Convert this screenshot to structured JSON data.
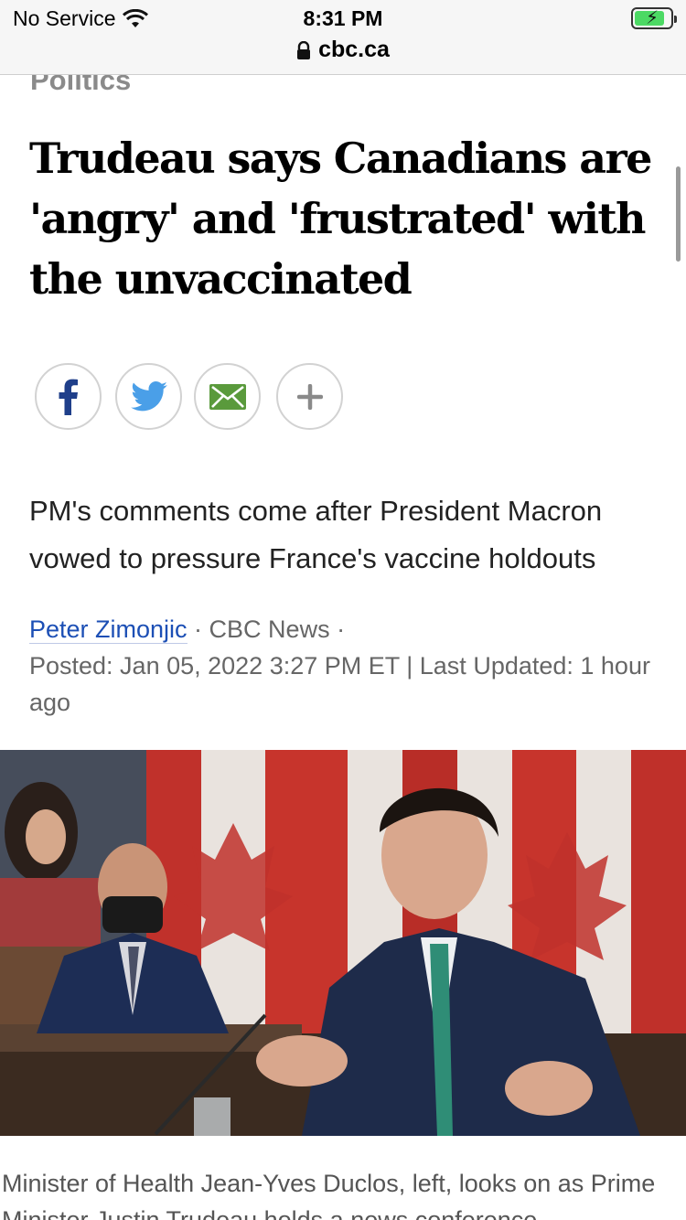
{
  "status_bar": {
    "carrier": "No Service",
    "time": "8:31 PM",
    "url": "cbc.ca",
    "battery_level": 0.85
  },
  "article": {
    "section": "Politics",
    "headline": "Trudeau says Canadians are 'angry' and 'frustrated' with the unvaccinated",
    "share_buttons": [
      "facebook-icon",
      "twitter-icon",
      "email-icon",
      "plus-icon"
    ],
    "deck": "PM's comments come after President Macron vowed to pressure France's vaccine holdouts",
    "byline": {
      "author": "Peter Zimonjic",
      "separator1": " · ",
      "outlet": "CBC News",
      "separator2": " ·",
      "posted": "Posted: Jan 05, 2022 3:27 PM ET | Last Updated: 1 hour ago"
    },
    "caption": "Minister of Health Jean-Yves Duclos, left, looks on as Prime Minister Justin Trudeau holds a news conference"
  },
  "colors": {
    "link": "#1c4fb5",
    "section": "#8a8a8a",
    "email_icon": "#5a9a3c",
    "twitter_icon": "#4a9fe8",
    "facebook_icon": "#1f3f8a"
  }
}
